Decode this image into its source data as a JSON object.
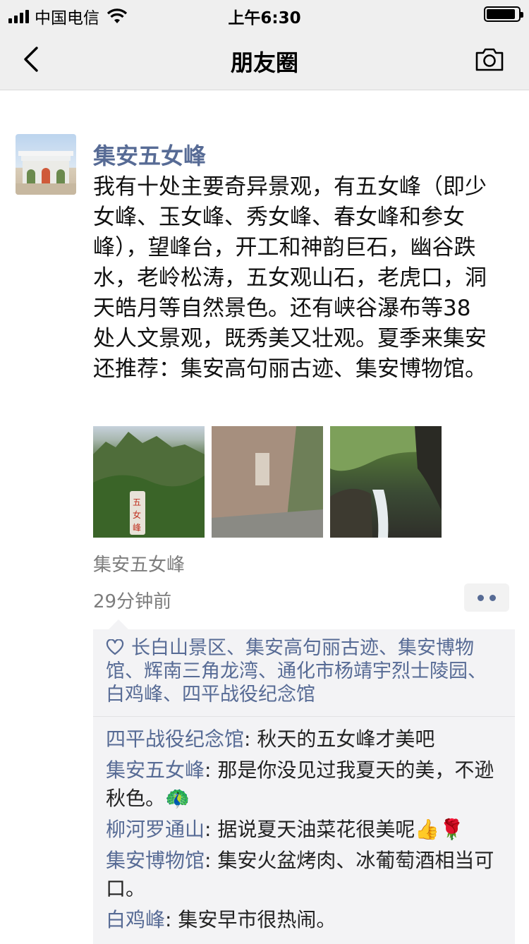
{
  "status_bar": {
    "carrier": "中国电信",
    "time": "上午6:30"
  },
  "nav": {
    "title": "朋友圈",
    "back_icon": "chevron-left-icon",
    "camera_icon": "camera-icon"
  },
  "post": {
    "author": "集安五女峰",
    "text": "我有十处主要奇异景观，有五女峰（即少女峰、玉女峰、秀女峰、春女峰和参女峰），望峰台，开工和神韵巨石，幽谷跌水，老岭松涛，五女观山石，老虎口，洞天皓月等自然景色。还有峡谷瀑布等38处人文景观，既秀美又壮观。夏季来集安还推荐：集安高句丽古迹、集安博物馆。",
    "photos": [
      "mountain-photo",
      "rock-inscription-photo",
      "waterfall-photo"
    ],
    "location": "集安五女峰",
    "time": "29分钟前"
  },
  "likes": {
    "icon": "heart-outline-icon",
    "text": "长白山景区、集安高句丽古迹、集安博物馆、辉南三角龙湾、通化市杨靖宇烈士陵园、白鸡峰、四平战役纪念馆"
  },
  "comments": [
    {
      "author": "四平战役纪念馆",
      "text": ": 秋天的五女峰才美吧"
    },
    {
      "author": "集安五女峰",
      "text": ": 那是你没见过我夏天的美，不逊秋色。🦚"
    },
    {
      "author": "柳河罗通山",
      "text": ": 据说夏天油菜花很美呢👍🌹"
    },
    {
      "author": "集安博物馆",
      "text": ": 集安火盆烤肉、冰葡萄酒相当可口。"
    },
    {
      "author": "白鸡峰",
      "text": ": 集安早市很热闹。"
    }
  ],
  "colors": {
    "link": "#576b95",
    "bar_bg": "#efefef",
    "comment_bg": "#f3f3f5"
  }
}
